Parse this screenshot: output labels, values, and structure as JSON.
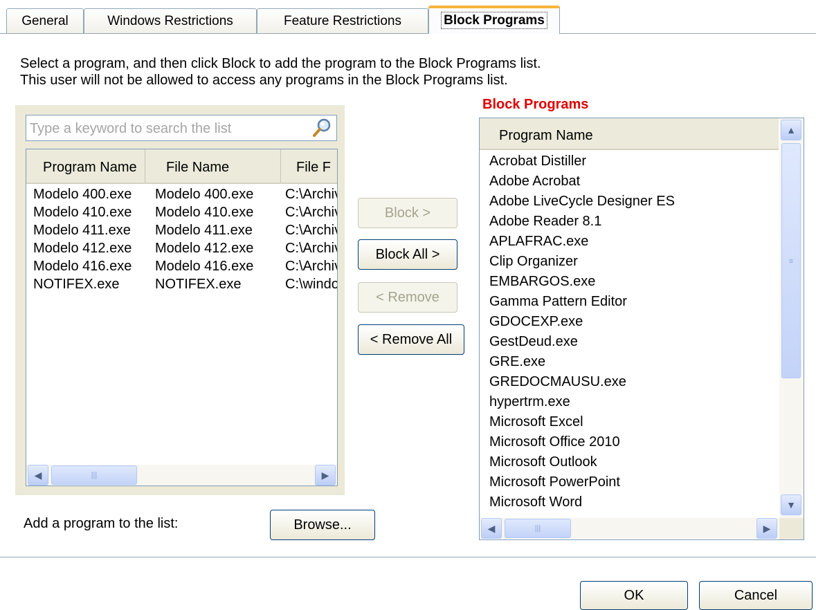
{
  "tabs": [
    {
      "label": "General",
      "active": false
    },
    {
      "label": "Windows Restrictions",
      "active": false
    },
    {
      "label": "Feature Restrictions",
      "active": false
    },
    {
      "label": "Block Programs",
      "active": true
    }
  ],
  "description": {
    "line1": "Select a program, and then click Block to add the program to the Block Programs list.",
    "line2": "This user will not be allowed to access any programs in the Block Programs list."
  },
  "search": {
    "placeholder": "Type a keyword to search the list",
    "icon": "search-icon"
  },
  "available_list": {
    "columns": [
      "Program Name",
      "File Name",
      "File F"
    ],
    "rows": [
      [
        "Modelo 400.exe",
        "Modelo 400.exe",
        "C:\\Archivos"
      ],
      [
        "Modelo 410.exe",
        "Modelo 410.exe",
        "C:\\Archivos"
      ],
      [
        "Modelo 411.exe",
        "Modelo 411.exe",
        "C:\\Archivos"
      ],
      [
        "Modelo 412.exe",
        "Modelo 412.exe",
        "C:\\Archivos"
      ],
      [
        "Modelo 416.exe",
        "Modelo 416.exe",
        "C:\\Archivos"
      ],
      [
        "NOTIFEX.exe",
        "NOTIFEX.exe",
        "C:\\windows"
      ]
    ]
  },
  "actions": {
    "block": "Block >",
    "block_all": "Block All >",
    "remove": "< Remove",
    "remove_all": "< Remove All"
  },
  "add_program": {
    "label": "Add a program to the list:",
    "browse": "Browse..."
  },
  "blocked": {
    "title": "Block Programs",
    "column": "Program Name",
    "items": [
      "Acrobat  Distiller",
      "Adobe Acrobat",
      "Adobe LiveCycle Designer ES",
      "Adobe Reader 8.1",
      "APLAFRAC.exe",
      "Clip Organizer",
      "EMBARGOS.exe",
      "Gamma Pattern Editor",
      "GDOCEXP.exe",
      "GestDeud.exe",
      "GRE.exe",
      "GREDOCMAUSU.exe",
      "hypertrm.exe",
      "Microsoft Excel",
      "Microsoft Office 2010",
      "Microsoft Outlook",
      "Microsoft PowerPoint",
      "Microsoft Word"
    ]
  },
  "dialog": {
    "ok": "OK",
    "cancel": "Cancel"
  },
  "colors": {
    "block_title": "#e00000",
    "active_tab_accent": "#f7b53a"
  }
}
